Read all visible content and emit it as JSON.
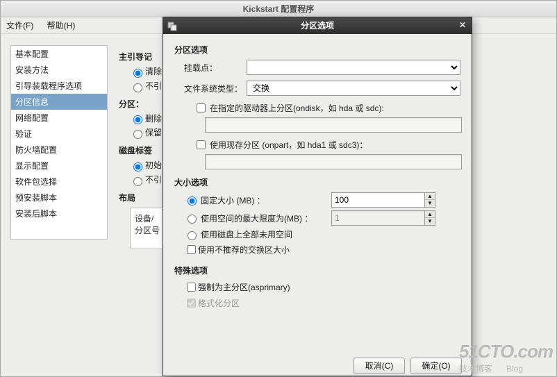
{
  "main_window": {
    "title": "Kickstart 配置程序",
    "menu": {
      "file": "文件(F)",
      "help": "帮助(H)"
    }
  },
  "sidebar": {
    "items": [
      "基本配置",
      "安装方法",
      "引导装载程序选项",
      "分区信息",
      "网络配置",
      "验证",
      "防火墙配置",
      "显示配置",
      "软件包选择",
      "预安装脚本",
      "安装后脚本"
    ],
    "selected_index": 3
  },
  "content": {
    "boot_record": {
      "title": "主引导记",
      "opt_clear": "清除",
      "opt_no": "不引"
    },
    "partition": {
      "title": "分区：",
      "opt_del": "删除",
      "opt_keep": "保留"
    },
    "disk_label": {
      "title": "磁盘标签",
      "opt_init": "初始",
      "opt_no": "不引"
    },
    "layout": {
      "title": "布局",
      "header": "设备/\n分区号"
    }
  },
  "dialog": {
    "title": "分区选项",
    "section_partition": "分区选项",
    "mount_label": "挂载点：",
    "fs_label": "文件系统类型：",
    "fs_value": "交换",
    "ondisk_cb": "在指定的驱动器上分区(ondisk，如 hda 或 sdc):",
    "onpart_cb": "使用现存分区 (onpart，如 hda1 或 sdc3)：",
    "section_size": "大小选项",
    "fixed_label": "固定大小 (MB) ：",
    "fixed_value": "100",
    "max_label": "使用空间的最大限度为(MB) ：",
    "max_value": "1",
    "grow_label": "使用磁盘上全部未用空间",
    "noswap_cb": "使用不推荐的交换区大小",
    "section_special": "特殊选项",
    "asprimary_cb": "强制为主分区(asprimary)",
    "format_cb": "格式化分区",
    "btn_cancel": "取消(C)",
    "btn_ok": "确定(O)"
  },
  "watermark": {
    "big": "51CTO.com",
    "small": "技术博客",
    "blog": "Blog"
  }
}
